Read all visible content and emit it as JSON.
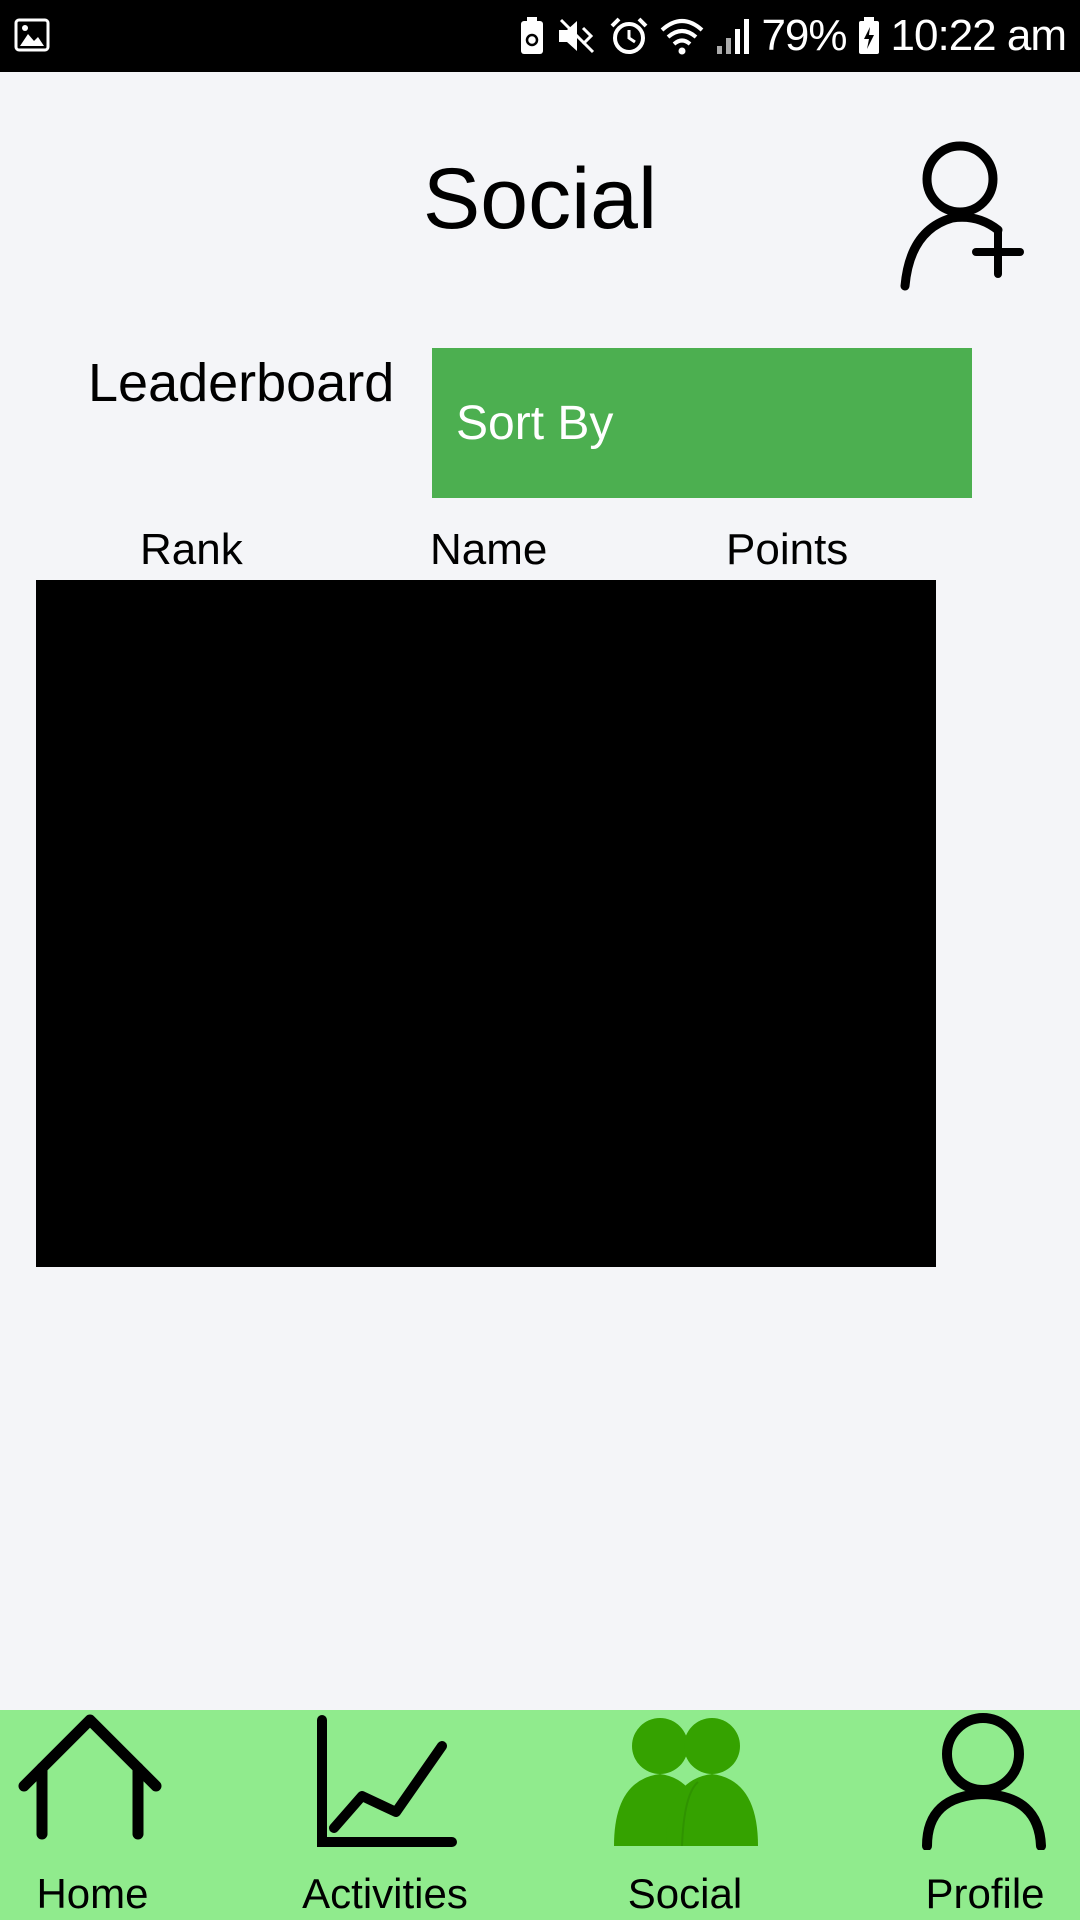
{
  "status_bar": {
    "battery_percent": "79%",
    "time": "10:22 am",
    "icons": [
      "gallery-icon",
      "battery-saver-icon",
      "mute-icon",
      "alarm-icon",
      "wifi-icon",
      "signal-icon",
      "battery-icon"
    ]
  },
  "header": {
    "title": "Social",
    "add_friend_icon": "add-user-icon"
  },
  "leaderboard": {
    "label": "Leaderboard",
    "sort_by_label": "Sort By",
    "sort_by_color": "#4caf50",
    "columns": [
      "Rank",
      "Name",
      "Points"
    ]
  },
  "nav": {
    "background": "#90eb8d",
    "active_color": "#35a200",
    "items": [
      {
        "label": "Home",
        "icon": "home-icon",
        "active": false
      },
      {
        "label": "Activities",
        "icon": "chart-icon",
        "active": false
      },
      {
        "label": "Social",
        "icon": "people-icon",
        "active": true
      },
      {
        "label": "Profile",
        "icon": "person-icon",
        "active": false
      }
    ]
  }
}
